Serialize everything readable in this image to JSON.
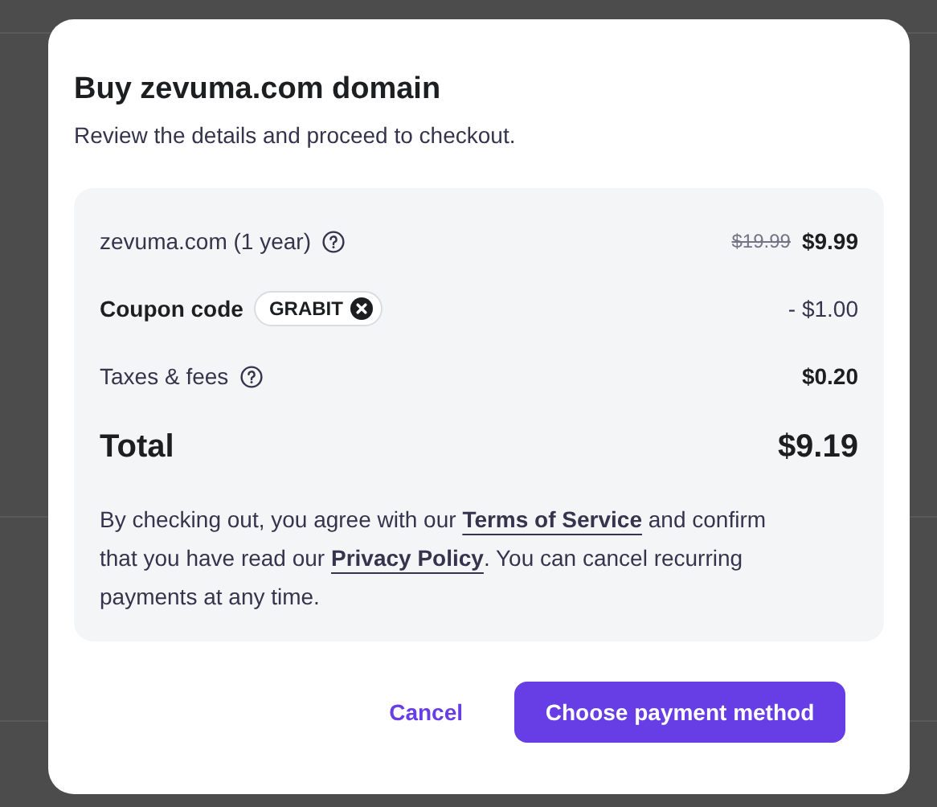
{
  "dialog": {
    "title": "Buy zevuma.com domain",
    "subtitle": "Review the details and proceed to checkout.",
    "items": [
      {
        "kind": "product",
        "label": "zevuma.com (1 year)",
        "help": true,
        "old_price": "$19.99",
        "price": "$9.99"
      },
      {
        "kind": "coupon",
        "label": "Coupon code",
        "code": "GRABIT",
        "price": "- $1.00"
      },
      {
        "kind": "fee",
        "label": "Taxes & fees",
        "help": true,
        "price": "$0.20"
      }
    ],
    "total": {
      "label": "Total",
      "value": "$9.19"
    },
    "terms": [
      {
        "kind": "text",
        "text": "By checking out, you agree with our "
      },
      {
        "kind": "link",
        "text": "Terms of Service"
      },
      {
        "kind": "text",
        "text": " and confirm that you have read our "
      },
      {
        "kind": "link",
        "text": "Privacy Policy"
      },
      {
        "kind": "text",
        "text": ". You can cancel recurring payments at any time."
      }
    ],
    "buttons": [
      {
        "kind": "secondary",
        "label": "Cancel"
      },
      {
        "kind": "primary",
        "label": "Choose payment method"
      }
    ]
  }
}
